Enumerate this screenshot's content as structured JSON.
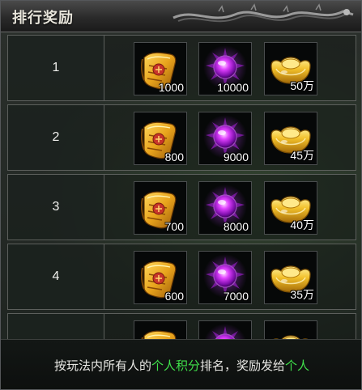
{
  "title": "排行奖励",
  "rows": [
    {
      "rank": "1",
      "scroll_qty": "1000",
      "gem_qty": "10000",
      "gold_qty": "50万"
    },
    {
      "rank": "2",
      "scroll_qty": "800",
      "gem_qty": "9000",
      "gold_qty": "45万"
    },
    {
      "rank": "3",
      "scroll_qty": "700",
      "gem_qty": "8000",
      "gold_qty": "40万"
    },
    {
      "rank": "4",
      "scroll_qty": "600",
      "gem_qty": "7000",
      "gold_qty": "35万"
    },
    {
      "rank": "",
      "scroll_qty": "",
      "gem_qty": "",
      "gold_qty": ""
    }
  ],
  "footer": {
    "part1": "按玩法内所有人的",
    "highlight1": "个人积分",
    "part2": "排名，奖励发给",
    "highlight2": "个人"
  },
  "colors": {
    "highlight": "#3fe04a",
    "text": "#e8e8e4",
    "slot_bg": "#060808"
  },
  "icons": {
    "scroll": "gold-scroll-icon",
    "gem": "purple-gem-icon",
    "gold": "gold-ingot-icon"
  }
}
